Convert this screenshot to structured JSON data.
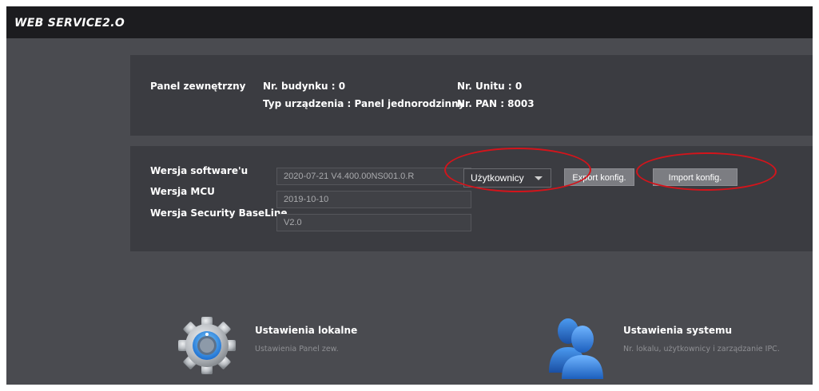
{
  "app": {
    "logo": "WEB SERVICE2.O"
  },
  "panel_info": {
    "device_label": "Panel zewnętrzny",
    "building": "Nr. budynku : 0",
    "unit": "Nr. Unitu : 0",
    "device_type": "Typ urządzenia : Panel jednorodzinny",
    "pan": "Nr. PAN : 8003"
  },
  "versions": {
    "software_label": "Wersja software'u",
    "software_value": "2020-07-21 V4.400.00NS001.0.R",
    "mcu_label": "Wersja MCU",
    "mcu_value": "2019-10-10",
    "security_label": "Wersja Security BaseLine",
    "security_value": "V2.0"
  },
  "config": {
    "select_value": "Użytkownicy",
    "export_label": "Export konfig.",
    "import_label": "Import konfig."
  },
  "tiles": [
    {
      "title": "Ustawienia lokalne",
      "subtitle": "Ustawienia Panel zew.",
      "icon": "gear-icon"
    },
    {
      "title": "Ustawienia systemu",
      "subtitle": "Nr. lokalu, użytkownicy i zarządzanie IPC.",
      "icon": "users-icon"
    }
  ],
  "colors": {
    "annotation": "#d4141b",
    "background": "#4a4b50",
    "panel": "#3b3c41",
    "button": "#7c7d82"
  }
}
